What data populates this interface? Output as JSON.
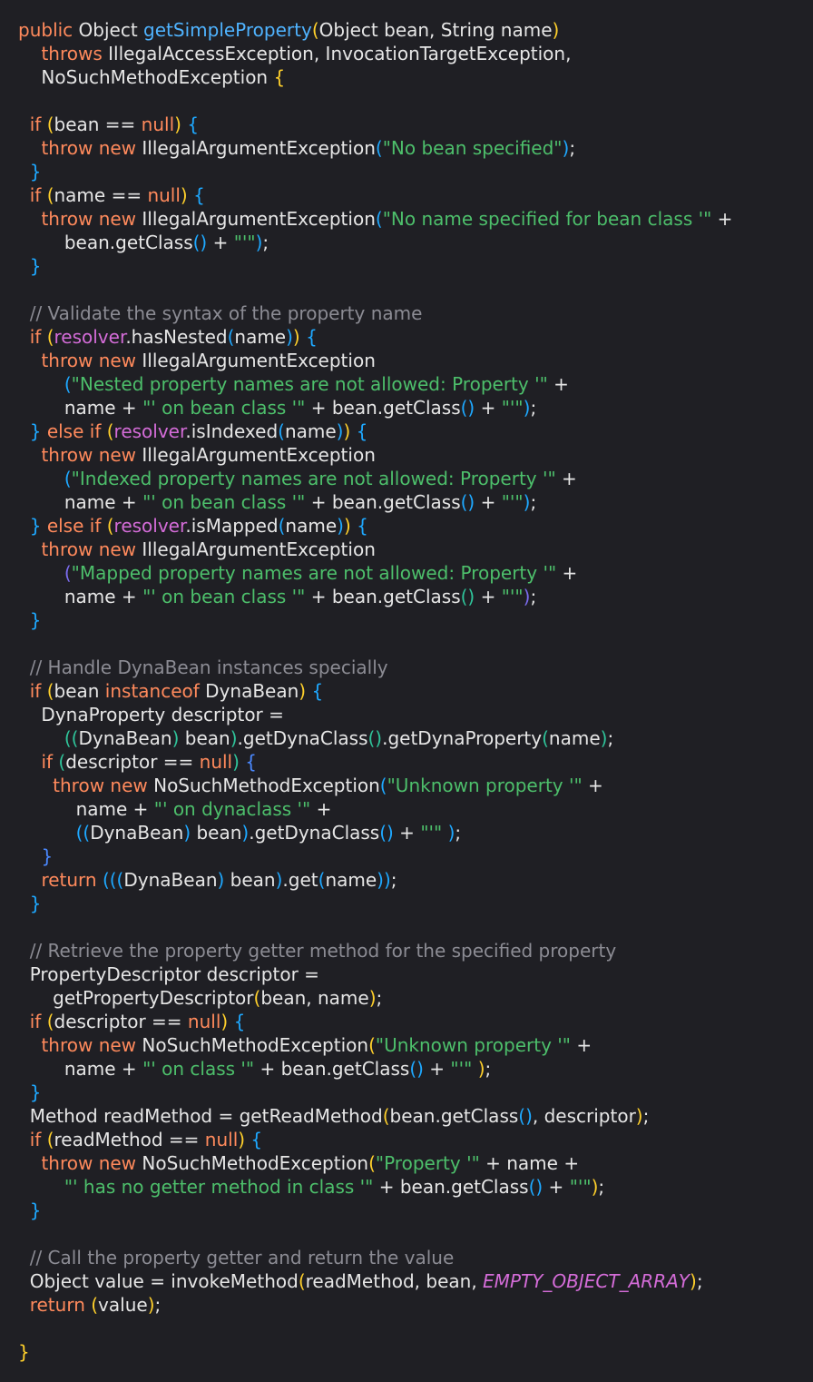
{
  "colors": {
    "background": "#1f1f24",
    "plain": "#e6e6e6",
    "keyword": "#ff8a5c",
    "function_name": "#4fb3ff",
    "string": "#4dbf6b",
    "comment": "#8c8c94",
    "bracket_yellow": "#ffd02b",
    "bracket_blue": "#1ea8ff",
    "bracket_purple": "#7b6cf0",
    "bracket_teal": "#2fc49a",
    "constant": "#d46cd8"
  },
  "lines": [
    [
      [
        "kw",
        "public"
      ],
      [
        "pl",
        " Object "
      ],
      [
        "fn",
        "getSimpleProperty"
      ],
      [
        "br1",
        "("
      ],
      [
        "pl",
        "Object bean, String name"
      ],
      [
        "br1",
        ")"
      ]
    ],
    [
      [
        "pl",
        "    "
      ],
      [
        "kw",
        "throws"
      ],
      [
        "pl",
        " IllegalAccessException, InvocationTargetException,"
      ]
    ],
    [
      [
        "pl",
        "    NoSuchMethodException "
      ],
      [
        "br1",
        "{"
      ]
    ],
    [],
    [
      [
        "pl",
        "  "
      ],
      [
        "kw",
        "if"
      ],
      [
        "pl",
        " "
      ],
      [
        "br1",
        "("
      ],
      [
        "pl",
        "bean == "
      ],
      [
        "kw",
        "null"
      ],
      [
        "br1",
        ")"
      ],
      [
        "pl",
        " "
      ],
      [
        "br2",
        "{"
      ]
    ],
    [
      [
        "pl",
        "    "
      ],
      [
        "kw",
        "throw new"
      ],
      [
        "pl",
        " IllegalArgumentException"
      ],
      [
        "br2",
        "("
      ],
      [
        "str",
        "\"No bean specified\""
      ],
      [
        "br2",
        ")"
      ],
      [
        "pl",
        ";"
      ]
    ],
    [
      [
        "pl",
        "  "
      ],
      [
        "br2",
        "}"
      ]
    ],
    [
      [
        "pl",
        "  "
      ],
      [
        "kw",
        "if"
      ],
      [
        "pl",
        " "
      ],
      [
        "br1",
        "("
      ],
      [
        "pl",
        "name == "
      ],
      [
        "kw",
        "null"
      ],
      [
        "br1",
        ")"
      ],
      [
        "pl",
        " "
      ],
      [
        "br2",
        "{"
      ]
    ],
    [
      [
        "pl",
        "    "
      ],
      [
        "kw",
        "throw new"
      ],
      [
        "pl",
        " IllegalArgumentException"
      ],
      [
        "br2",
        "("
      ],
      [
        "str",
        "\"No name specified for bean class '\""
      ],
      [
        "pl",
        " +"
      ]
    ],
    [
      [
        "pl",
        "        bean.getClass"
      ],
      [
        "br2",
        "()"
      ],
      [
        "pl",
        " + "
      ],
      [
        "str",
        "\"'\""
      ],
      [
        "br2",
        ")"
      ],
      [
        "pl",
        ";"
      ]
    ],
    [
      [
        "pl",
        "  "
      ],
      [
        "br2",
        "}"
      ]
    ],
    [],
    [
      [
        "pl",
        "  "
      ],
      [
        "cmt",
        "// Validate the syntax of the property name"
      ]
    ],
    [
      [
        "pl",
        "  "
      ],
      [
        "kw",
        "if"
      ],
      [
        "pl",
        " "
      ],
      [
        "br1",
        "("
      ],
      [
        "fld",
        "resolver"
      ],
      [
        "pl",
        ".hasNested"
      ],
      [
        "br2",
        "("
      ],
      [
        "pl",
        "name"
      ],
      [
        "br2",
        ")"
      ],
      [
        "br1",
        ")"
      ],
      [
        "pl",
        " "
      ],
      [
        "br2",
        "{"
      ]
    ],
    [
      [
        "pl",
        "    "
      ],
      [
        "kw",
        "throw new"
      ],
      [
        "pl",
        " IllegalArgumentException"
      ]
    ],
    [
      [
        "pl",
        "        "
      ],
      [
        "br2",
        "("
      ],
      [
        "str",
        "\"Nested property names are not allowed: Property '\""
      ],
      [
        "pl",
        " +"
      ]
    ],
    [
      [
        "pl",
        "        name + "
      ],
      [
        "str",
        "\"' on bean class '\""
      ],
      [
        "pl",
        " + bean.getClass"
      ],
      [
        "br2",
        "()"
      ],
      [
        "pl",
        " + "
      ],
      [
        "str",
        "\"'\""
      ],
      [
        "br2",
        ")"
      ],
      [
        "pl",
        ";"
      ]
    ],
    [
      [
        "pl",
        "  "
      ],
      [
        "br2",
        "}"
      ],
      [
        "pl",
        " "
      ],
      [
        "kw",
        "else if"
      ],
      [
        "pl",
        " "
      ],
      [
        "br1",
        "("
      ],
      [
        "fld",
        "resolver"
      ],
      [
        "pl",
        ".isIndexed"
      ],
      [
        "br2",
        "("
      ],
      [
        "pl",
        "name"
      ],
      [
        "br2",
        ")"
      ],
      [
        "br1",
        ")"
      ],
      [
        "pl",
        " "
      ],
      [
        "br2",
        "{"
      ]
    ],
    [
      [
        "pl",
        "    "
      ],
      [
        "kw",
        "throw new"
      ],
      [
        "pl",
        " IllegalArgumentException"
      ]
    ],
    [
      [
        "pl",
        "        "
      ],
      [
        "br2",
        "("
      ],
      [
        "str",
        "\"Indexed property names are not allowed: Property '\""
      ],
      [
        "pl",
        " +"
      ]
    ],
    [
      [
        "pl",
        "        name + "
      ],
      [
        "str",
        "\"' on bean class '\""
      ],
      [
        "pl",
        " + bean.getClass"
      ],
      [
        "br2",
        "()"
      ],
      [
        "pl",
        " + "
      ],
      [
        "str",
        "\"'\""
      ],
      [
        "br2",
        ")"
      ],
      [
        "pl",
        ";"
      ]
    ],
    [
      [
        "pl",
        "  "
      ],
      [
        "br2",
        "}"
      ],
      [
        "pl",
        " "
      ],
      [
        "kw",
        "else if"
      ],
      [
        "pl",
        " "
      ],
      [
        "br1",
        "("
      ],
      [
        "fld",
        "resolver"
      ],
      [
        "pl",
        ".isMapped"
      ],
      [
        "br2",
        "("
      ],
      [
        "pl",
        "name"
      ],
      [
        "br2",
        ")"
      ],
      [
        "br1",
        ")"
      ],
      [
        "pl",
        " "
      ],
      [
        "br2",
        "{"
      ]
    ],
    [
      [
        "pl",
        "    "
      ],
      [
        "kw",
        "throw new"
      ],
      [
        "pl",
        " IllegalArgumentException"
      ]
    ],
    [
      [
        "pl",
        "        "
      ],
      [
        "br3",
        "("
      ],
      [
        "str",
        "\"Mapped property names are not allowed: Property '\""
      ],
      [
        "pl",
        " +"
      ]
    ],
    [
      [
        "pl",
        "        name + "
      ],
      [
        "str",
        "\"' on bean class '\""
      ],
      [
        "pl",
        " + bean.getClass"
      ],
      [
        "br4",
        "()"
      ],
      [
        "pl",
        " + "
      ],
      [
        "str",
        "\"'\""
      ],
      [
        "br3",
        ")"
      ],
      [
        "pl",
        ";"
      ]
    ],
    [
      [
        "pl",
        "  "
      ],
      [
        "br2",
        "}"
      ]
    ],
    [],
    [
      [
        "pl",
        "  "
      ],
      [
        "cmt",
        "// Handle DynaBean instances specially"
      ]
    ],
    [
      [
        "pl",
        "  "
      ],
      [
        "kw",
        "if"
      ],
      [
        "pl",
        " "
      ],
      [
        "br1",
        "("
      ],
      [
        "pl",
        "bean "
      ],
      [
        "kw",
        "instanceof"
      ],
      [
        "pl",
        " DynaBean"
      ],
      [
        "br1",
        ")"
      ],
      [
        "pl",
        " "
      ],
      [
        "br2",
        "{"
      ]
    ],
    [
      [
        "pl",
        "    DynaProperty descriptor ="
      ]
    ],
    [
      [
        "pl",
        "        "
      ],
      [
        "br4",
        "(("
      ],
      [
        "pl",
        "DynaBean"
      ],
      [
        "br4",
        ")"
      ],
      [
        "pl",
        " bean"
      ],
      [
        "br4",
        ")"
      ],
      [
        "pl",
        ".getDynaClass"
      ],
      [
        "br4",
        "()"
      ],
      [
        "pl",
        ".getDynaProperty"
      ],
      [
        "br4",
        "("
      ],
      [
        "pl",
        "name"
      ],
      [
        "br4",
        ")"
      ],
      [
        "pl",
        ";"
      ]
    ],
    [
      [
        "pl",
        "    "
      ],
      [
        "kw",
        "if"
      ],
      [
        "pl",
        " "
      ],
      [
        "br4",
        "("
      ],
      [
        "pl",
        "descriptor == "
      ],
      [
        "kw",
        "null"
      ],
      [
        "br4",
        ")"
      ],
      [
        "pl",
        " "
      ],
      [
        "br5",
        "{"
      ]
    ],
    [
      [
        "pl",
        "      "
      ],
      [
        "kw",
        "throw new"
      ],
      [
        "pl",
        " NoSuchMethodException"
      ],
      [
        "br2",
        "("
      ],
      [
        "str",
        "\"Unknown property '\""
      ],
      [
        "pl",
        " +"
      ]
    ],
    [
      [
        "pl",
        "          name + "
      ],
      [
        "str",
        "\"' on dynaclass '\""
      ],
      [
        "pl",
        " +"
      ]
    ],
    [
      [
        "pl",
        "          "
      ],
      [
        "br2",
        "(("
      ],
      [
        "pl",
        "DynaBean"
      ],
      [
        "br2",
        ")"
      ],
      [
        "pl",
        " bean"
      ],
      [
        "br2",
        ")"
      ],
      [
        "pl",
        ".getDynaClass"
      ],
      [
        "br2",
        "()"
      ],
      [
        "pl",
        " + "
      ],
      [
        "str",
        "\"'\""
      ],
      [
        "pl",
        " "
      ],
      [
        "br2",
        ")"
      ],
      [
        "pl",
        ";"
      ]
    ],
    [
      [
        "pl",
        "    "
      ],
      [
        "br5",
        "}"
      ]
    ],
    [
      [
        "pl",
        "    "
      ],
      [
        "kw",
        "return"
      ],
      [
        "pl",
        " "
      ],
      [
        "br2",
        "((("
      ],
      [
        "pl",
        "DynaBean"
      ],
      [
        "br2",
        ")"
      ],
      [
        "pl",
        " bean"
      ],
      [
        "br2",
        ")"
      ],
      [
        "pl",
        ".get"
      ],
      [
        "br2",
        "("
      ],
      [
        "pl",
        "name"
      ],
      [
        "br2",
        "))"
      ],
      [
        "pl",
        ";"
      ]
    ],
    [
      [
        "pl",
        "  "
      ],
      [
        "br2",
        "}"
      ]
    ],
    [],
    [
      [
        "pl",
        "  "
      ],
      [
        "cmt",
        "// Retrieve the property getter method for the specified property"
      ]
    ],
    [
      [
        "pl",
        "  PropertyDescriptor descriptor ="
      ]
    ],
    [
      [
        "pl",
        "      getPropertyDescriptor"
      ],
      [
        "br1",
        "("
      ],
      [
        "pl",
        "bean, name"
      ],
      [
        "br1",
        ")"
      ],
      [
        "pl",
        ";"
      ]
    ],
    [
      [
        "pl",
        "  "
      ],
      [
        "kw",
        "if"
      ],
      [
        "pl",
        " "
      ],
      [
        "br1",
        "("
      ],
      [
        "pl",
        "descriptor == "
      ],
      [
        "kw",
        "null"
      ],
      [
        "br1",
        ")"
      ],
      [
        "pl",
        " "
      ],
      [
        "br2",
        "{"
      ]
    ],
    [
      [
        "pl",
        "    "
      ],
      [
        "kw",
        "throw new"
      ],
      [
        "pl",
        " NoSuchMethodException"
      ],
      [
        "br1",
        "("
      ],
      [
        "str",
        "\"Unknown property '\""
      ],
      [
        "pl",
        " +"
      ]
    ],
    [
      [
        "pl",
        "        name + "
      ],
      [
        "str",
        "\"' on class '\""
      ],
      [
        "pl",
        " + bean.getClass"
      ],
      [
        "br2",
        "()"
      ],
      [
        "pl",
        " + "
      ],
      [
        "str",
        "\"'\""
      ],
      [
        "pl",
        " "
      ],
      [
        "br1",
        ")"
      ],
      [
        "pl",
        ";"
      ]
    ],
    [
      [
        "pl",
        "  "
      ],
      [
        "br2",
        "}"
      ]
    ],
    [
      [
        "pl",
        "  Method readMethod = getReadMethod"
      ],
      [
        "br1",
        "("
      ],
      [
        "pl",
        "bean.getClass"
      ],
      [
        "br2",
        "()"
      ],
      [
        "pl",
        ", descriptor"
      ],
      [
        "br1",
        ")"
      ],
      [
        "pl",
        ";"
      ]
    ],
    [
      [
        "pl",
        "  "
      ],
      [
        "kw",
        "if"
      ],
      [
        "pl",
        " "
      ],
      [
        "br1",
        "("
      ],
      [
        "pl",
        "readMethod == "
      ],
      [
        "kw",
        "null"
      ],
      [
        "br1",
        ")"
      ],
      [
        "pl",
        " "
      ],
      [
        "br2",
        "{"
      ]
    ],
    [
      [
        "pl",
        "    "
      ],
      [
        "kw",
        "throw new"
      ],
      [
        "pl",
        " NoSuchMethodException"
      ],
      [
        "br1",
        "("
      ],
      [
        "str",
        "\"Property '\""
      ],
      [
        "pl",
        " + name +"
      ]
    ],
    [
      [
        "pl",
        "        "
      ],
      [
        "str",
        "\"' has no getter method in class '\""
      ],
      [
        "pl",
        " + bean.getClass"
      ],
      [
        "br2",
        "()"
      ],
      [
        "pl",
        " + "
      ],
      [
        "str",
        "\"'\""
      ],
      [
        "br1",
        ")"
      ],
      [
        "pl",
        ";"
      ]
    ],
    [
      [
        "pl",
        "  "
      ],
      [
        "br2",
        "}"
      ]
    ],
    [],
    [
      [
        "pl",
        "  "
      ],
      [
        "cmt",
        "// Call the property getter and return the value"
      ]
    ],
    [
      [
        "pl",
        "  Object value = invokeMethod"
      ],
      [
        "br1",
        "("
      ],
      [
        "pl",
        "readMethod, bean, "
      ],
      [
        "const",
        "EMPTY_OBJECT_ARRAY"
      ],
      [
        "br1",
        ")"
      ],
      [
        "pl",
        ";"
      ]
    ],
    [
      [
        "pl",
        "  "
      ],
      [
        "kw",
        "return"
      ],
      [
        "pl",
        " "
      ],
      [
        "br1",
        "("
      ],
      [
        "pl",
        "value"
      ],
      [
        "br1",
        ")"
      ],
      [
        "pl",
        ";"
      ]
    ],
    [],
    [
      [
        "br1",
        "}"
      ]
    ]
  ]
}
